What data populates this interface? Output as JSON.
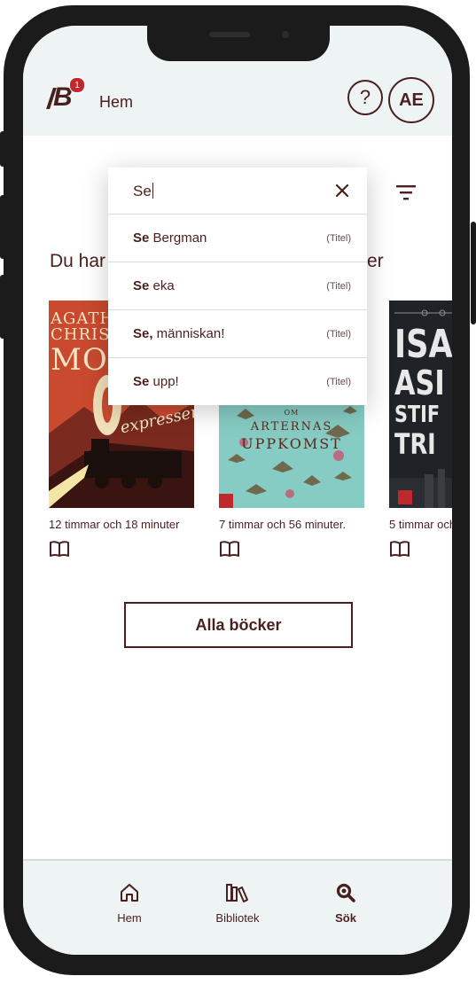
{
  "header": {
    "logo_text": "B",
    "notification_count": "1",
    "title": "Hem",
    "help_label": "?",
    "avatar_initials": "AE"
  },
  "search": {
    "value": "Se",
    "suggestions": [
      {
        "bold": "Se",
        "rest": " Bergman",
        "tag": "(Titel)"
      },
      {
        "bold": "Se",
        "rest": " eka",
        "tag": "(Titel)"
      },
      {
        "bold": "Se,",
        "rest": " människan!",
        "tag": "(Titel)"
      },
      {
        "bold": "Se",
        "rest": " upp!",
        "tag": "(Titel)"
      }
    ]
  },
  "section": {
    "title_start": "Du har",
    "title_end": "er"
  },
  "books": [
    {
      "duration": "12 timmar och 18 minuter",
      "cover_lines": [
        "AGATH",
        "CHRIS",
        "MOR",
        "expressen"
      ]
    },
    {
      "duration": "7 timmar och 56 minuter.",
      "cover_lines": [
        "OM",
        "ARTERNAS",
        "UPPKOMST"
      ]
    },
    {
      "duration": "5 timmar och",
      "cover_lines": [
        "ISA",
        "ASI",
        "STIF",
        "TRI"
      ]
    }
  ],
  "all_books_label": "Alla böcker",
  "tabs": [
    {
      "label": "Hem",
      "icon": "home-icon"
    },
    {
      "label": "Bibliotek",
      "icon": "library-icon"
    },
    {
      "label": "Sök",
      "icon": "search-icon"
    }
  ],
  "colors": {
    "brand": "#4a1f1f",
    "header_bg": "#eef4f3",
    "badge": "#c0282d"
  }
}
